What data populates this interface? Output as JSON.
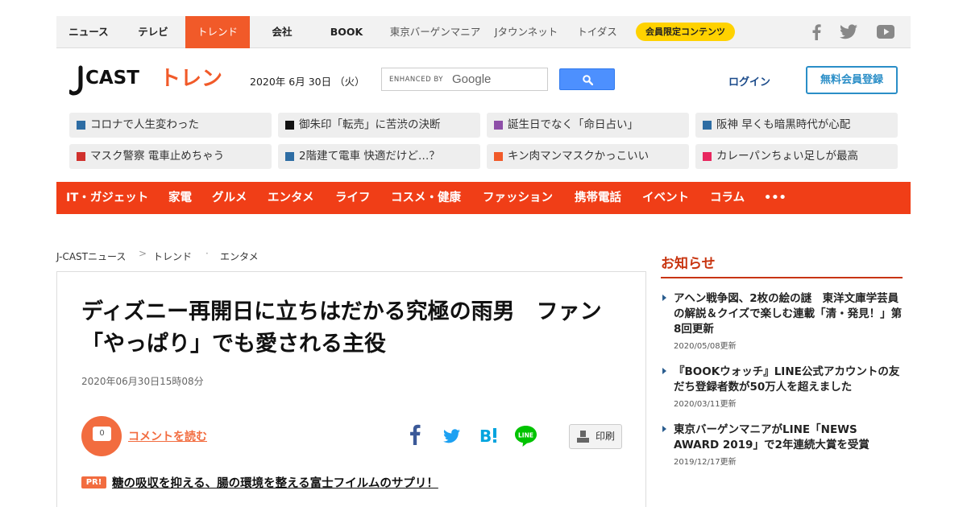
{
  "topnav": {
    "items": [
      "ニュース",
      "テレビ",
      "トレンド",
      "会社",
      "BOOK"
    ],
    "sub_items": [
      "東京バーゲンマニア",
      "Jタウンネット",
      "トイダス"
    ],
    "member": "会員限定コンテンツ",
    "sns": [
      "facebook-icon",
      "twitter-icon",
      "youtube-icon"
    ]
  },
  "header": {
    "logo_main": "J CAST",
    "logo_sub": "トレンド",
    "date": "2020年 6月 30日 （火）",
    "search_label": "ENHANCED BY",
    "search_brand": "Google",
    "login": "ログイン",
    "register": "無料会員登録"
  },
  "topics": [
    {
      "label": "コロナで人生変わった",
      "color": "#2e6da4"
    },
    {
      "label": "御朱印「転売」に苦渋の決断",
      "color": "#111111"
    },
    {
      "label": "誕生日でなく「命日占い」",
      "color": "#8e4fa8"
    },
    {
      "label": "阪神 早くも暗黒時代が心配",
      "color": "#2e6da4"
    },
    {
      "label": "マスク警察 電車止めちゃう",
      "color": "#d0312d"
    },
    {
      "label": "2階建て電車 快適だけど…？",
      "color": "#2e6da4"
    },
    {
      "label": "キン肉マンマスクかっこいい",
      "color": "#f15a29"
    },
    {
      "label": "カレーパンちょい足しが最高",
      "color": "#e8275f"
    }
  ],
  "categories": [
    "IT・ガジェット",
    "家電",
    "グルメ",
    "エンタメ",
    "ライフ",
    "コスメ・健康",
    "ファッション",
    "携帯電話",
    "イベント",
    "コラム",
    "•••"
  ],
  "breadcrumb": [
    "J-CASTニュース",
    "トレンド",
    "エンタメ"
  ],
  "article": {
    "headline": "ディズニー再開日に立ちはだかる究極の雨男　ファン「やっぱり」でも愛される主役",
    "pubdate": "2020年06月30日15時08分",
    "comment_count": "0",
    "comment_link": "コメントを読む",
    "print": "印刷",
    "pr_badge": "PR!",
    "pr_text": "糖の吸収を抑える、腸の環境を整える富士フイルムのサプリ！"
  },
  "sidebar": {
    "title": "お知らせ",
    "news": [
      {
        "title": "アヘン戦争図、2枚の絵の謎　東洋文庫学芸員の解説＆クイズで楽しむ連載「清・発見！」第8回更新",
        "date": "2020/05/08更新"
      },
      {
        "title": "『BOOKウォッチ』LINE公式アカウントの友だち登録者数が50万人を超えました",
        "date": "2020/03/11更新"
      },
      {
        "title": "東京バーゲンマニアがLINE「NEWS AWARD 2019」で2年連続大賞を受賞",
        "date": "2019/12/17更新"
      }
    ]
  }
}
